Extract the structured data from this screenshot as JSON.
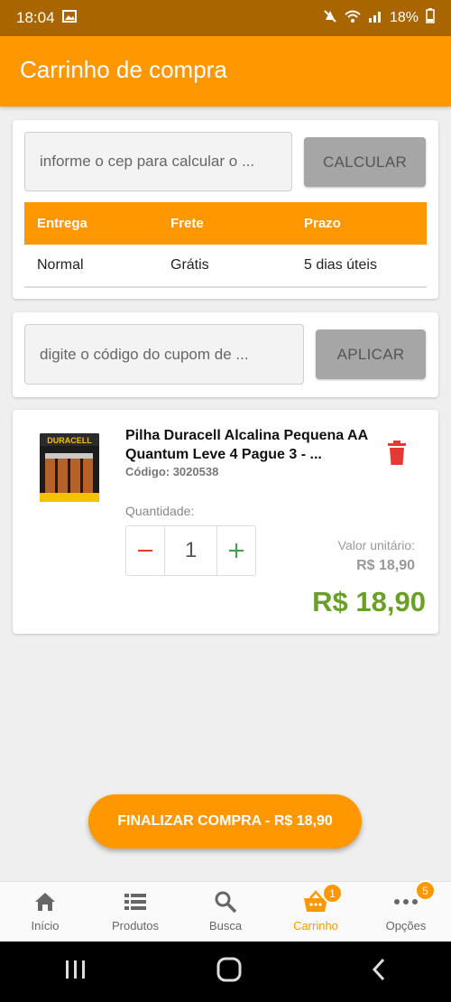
{
  "status": {
    "time": "18:04",
    "battery": "18%"
  },
  "header": {
    "title": "Carrinho de compra"
  },
  "shipping": {
    "cep_placeholder": "informe o cep para calcular o ...",
    "calc_label": "CALCULAR",
    "columns": [
      "Entrega",
      "Frete",
      "Prazo"
    ],
    "row": {
      "delivery": "Normal",
      "freight": "Grátis",
      "deadline": "5 dias úteis"
    }
  },
  "coupon": {
    "placeholder": "digite o código do cupom de ...",
    "apply_label": "APLICAR"
  },
  "product": {
    "brand": "DURACELL",
    "title": "Pilha Duracell Alcalina Pequena AA Quantum Leve 4 Pague 3 - ...",
    "code": "Código: 3020538",
    "qty_label": "Quantidade:",
    "qty": "1",
    "unit_label": "Valor unitário:",
    "unit_price": "R$ 18,90",
    "total": "R$ 18,90"
  },
  "checkout": {
    "label": "FINALIZAR COMPRA - R$ 18,90"
  },
  "nav": {
    "items": [
      {
        "label": "Início",
        "icon": "home-icon"
      },
      {
        "label": "Produtos",
        "icon": "list-icon"
      },
      {
        "label": "Busca",
        "icon": "search-icon"
      },
      {
        "label": "Carrinho",
        "icon": "cart-icon",
        "badge": "1"
      },
      {
        "label": "Opções",
        "icon": "more-icon",
        "badge": "5"
      }
    ]
  },
  "colors": {
    "primary": "#ff9800",
    "price": "#6aa025",
    "delete": "#e53935"
  }
}
